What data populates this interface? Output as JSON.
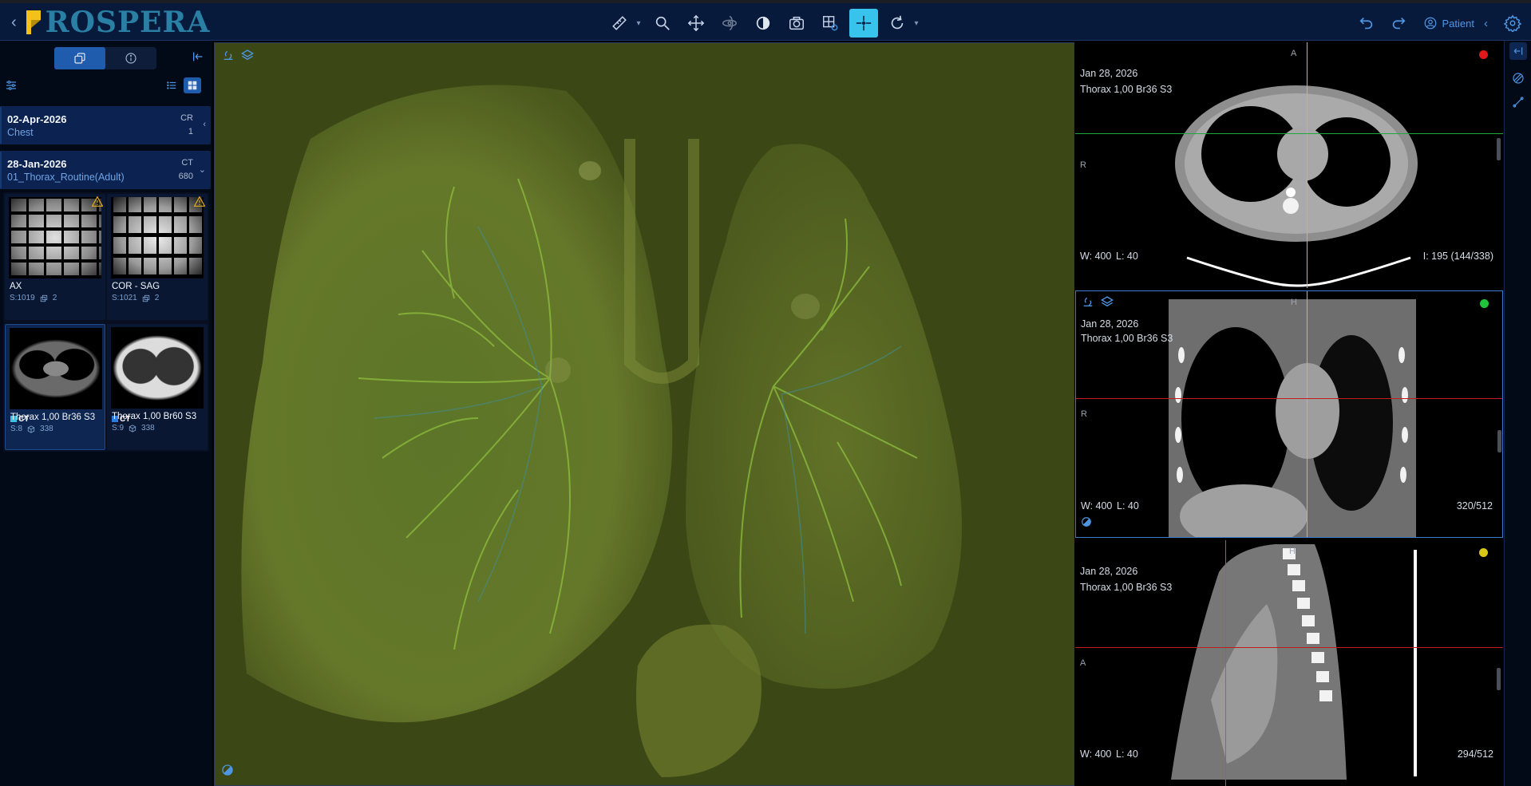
{
  "app": {
    "logo_text": "ROSPERA"
  },
  "toolbar": {
    "tools": [
      "measure-icon",
      "zoom-icon",
      "pan-icon",
      "rotate-3d-icon",
      "window-level-icon",
      "camera-icon",
      "layout-settings-icon",
      "crosshair-icon",
      "reset-rotate-icon"
    ],
    "active_tool": "crosshair-icon",
    "patient_label": "Patient"
  },
  "left_panel": {
    "studies": [
      {
        "date": "02-Apr-2026",
        "description": "Chest",
        "modality": "CR",
        "count": "1"
      },
      {
        "date": "28-Jan-2026",
        "description": "01_Thorax_Routine(Adult)",
        "modality": "CT",
        "count": "680"
      }
    ],
    "series": [
      {
        "name": "AX",
        "series_no": "S:1019",
        "count": "2",
        "type": "multi",
        "warning": true
      },
      {
        "name": "COR - SAG",
        "series_no": "S:1021",
        "count": "2",
        "type": "multi",
        "warning": true
      },
      {
        "name": "Thorax 1,00 Br36 S3",
        "series_no": "S:8",
        "count": "338",
        "type": "ct",
        "modality": "CT",
        "selected": true
      },
      {
        "name": "Thorax 1,00 Br60 S3",
        "series_no": "S:9",
        "count": "338",
        "type": "ct",
        "modality": "CT"
      }
    ]
  },
  "viewports": {
    "axial": {
      "date": "Jan 28, 2026",
      "series": "Thorax 1,00 Br36 S3",
      "ww": "W: 400",
      "wl": "L: 40",
      "index": "I: 195 (144/338)",
      "top_orient": "A",
      "left_orient": "R",
      "dot_color": "#e01818"
    },
    "coronal": {
      "date": "Jan 28, 2026",
      "series": "Thorax 1,00 Br36 S3",
      "ww": "W: 400",
      "wl": "L: 40",
      "index": "320/512",
      "top_orient": "H",
      "left_orient": "R",
      "dot_color": "#1fc43a"
    },
    "sagittal": {
      "date": "Jan 28, 2026",
      "series": "Thorax 1,00 Br36 S3",
      "ww": "W: 400",
      "wl": "L: 40",
      "index": "294/512",
      "top_orient": "H",
      "left_orient": "A",
      "dot_color": "#d9c718"
    }
  }
}
